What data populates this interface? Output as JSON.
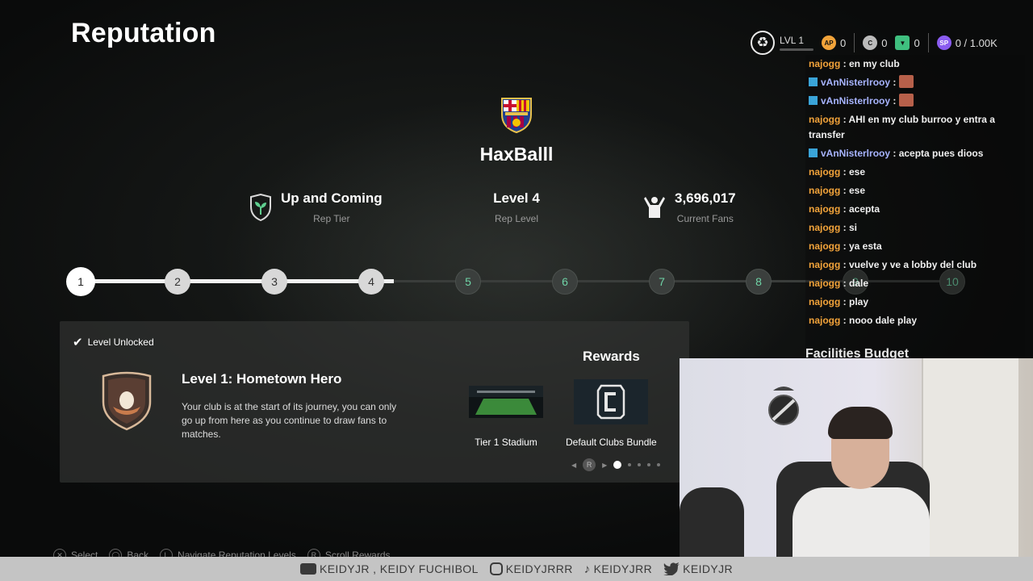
{
  "header": {
    "title": "Reputation"
  },
  "hud": {
    "level": "LVL 1",
    "ap": "0",
    "ap_icon": "AP",
    "coins": "0",
    "shards": "0",
    "sp_icon": "SP",
    "sp": "0 / 1.00K",
    "colors": {
      "ap": "#f2a33a",
      "shards": "#3fbf7f",
      "sp": "#8a5cf0"
    }
  },
  "club": {
    "name": "HaxBalll",
    "tier": {
      "value": "Up and Coming",
      "label": "Rep Tier"
    },
    "level": {
      "value": "Level 4",
      "label": "Rep Level"
    },
    "fans": {
      "value": "3,696,017",
      "label": "Current Fans"
    }
  },
  "track": {
    "nodes": [
      "1",
      "2",
      "3",
      "4",
      "5",
      "6",
      "7",
      "8",
      "9",
      "10"
    ],
    "reached": 4
  },
  "detail": {
    "status": "Level Unlocked",
    "title": "Level 1: Hometown Hero",
    "description": "Your club is at the start of its journey, you can only go up from here as you continue to draw fans to matches.",
    "rewards_title": "Rewards",
    "rewards": [
      {
        "label": "Tier 1 Stadium"
      },
      {
        "label": "Default Clubs Bundle"
      }
    ],
    "pager_button": "R"
  },
  "hints": [
    {
      "key": "✕",
      "label": "Select"
    },
    {
      "key": "◯",
      "label": "Back"
    },
    {
      "key": "L",
      "label": "Navigate Reputation Levels"
    },
    {
      "key": "R",
      "label": "Scroll Rewards"
    }
  ],
  "chat": {
    "messages": [
      {
        "user": "najogg",
        "text": ": en my club"
      },
      {
        "user": "vAnNisterlrooy",
        "text": ":"
      },
      {
        "user": "vAnNisterlrooy",
        "text": ":"
      },
      {
        "user": "najogg",
        "text": ": AHI en my club burroo y entra a transfer"
      },
      {
        "user": "vAnNisterlrooy",
        "text": ": acepta pues dioos"
      },
      {
        "user": "najogg",
        "text": ": ese"
      },
      {
        "user": "najogg",
        "text": ": ese"
      },
      {
        "user": "najogg",
        "text": ": acepta"
      },
      {
        "user": "najogg",
        "text": ": si"
      },
      {
        "user": "najogg",
        "text": ": ya esta"
      },
      {
        "user": "najogg",
        "text": ": vuelve y ve a lobby del club"
      },
      {
        "user": "najogg",
        "text": ": dale"
      },
      {
        "user": "najogg",
        "text": ": play"
      },
      {
        "user": "najogg",
        "text": ": nooo dale play"
      }
    ],
    "facilities": "Facilities Budget"
  },
  "social": {
    "youtube": "KEIDYJR , KEIDY FUCHIBOL",
    "instagram": "KEIDYJRRR",
    "tiktok": "KEIDYJRR",
    "twitter": "KEIDYJR"
  }
}
